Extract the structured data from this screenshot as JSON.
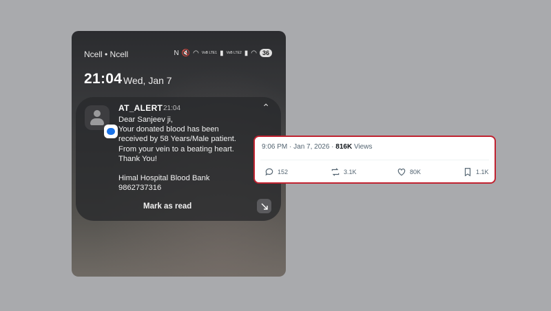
{
  "phone": {
    "status_bar": {
      "carrier": "Ncell • Ncell",
      "icons": [
        "nfc-icon",
        "mute-icon",
        "wifi-icon",
        "signal-icon",
        "signal-icon",
        "wifi-icon"
      ],
      "volte_label_1": "VoB LTE1",
      "volte_label_2": "VoB LTE2",
      "battery": "36"
    },
    "lockscreen": {
      "time": "21:04",
      "date": "Wed, Jan 7"
    },
    "notification": {
      "app_name": "AT_ALERT",
      "time": "21:04",
      "lines": [
        "Dear Sanjeev ji,",
        "Your donated blood has been",
        "received by 58 Years/Male patient.",
        "From your vein to a beating heart.",
        "Thank You!",
        "Himal Hospital Blood Bank",
        "9862737316"
      ],
      "action": "Mark as read"
    }
  },
  "tweet": {
    "time": "9:06 PM · Jan 7, 2026 · ",
    "views_count": "816K",
    "views_label": " Views",
    "replies": "152",
    "reposts": "3.1K",
    "likes": "80K",
    "bookmarks": "1.1K",
    "border_color": "#c0212f"
  }
}
